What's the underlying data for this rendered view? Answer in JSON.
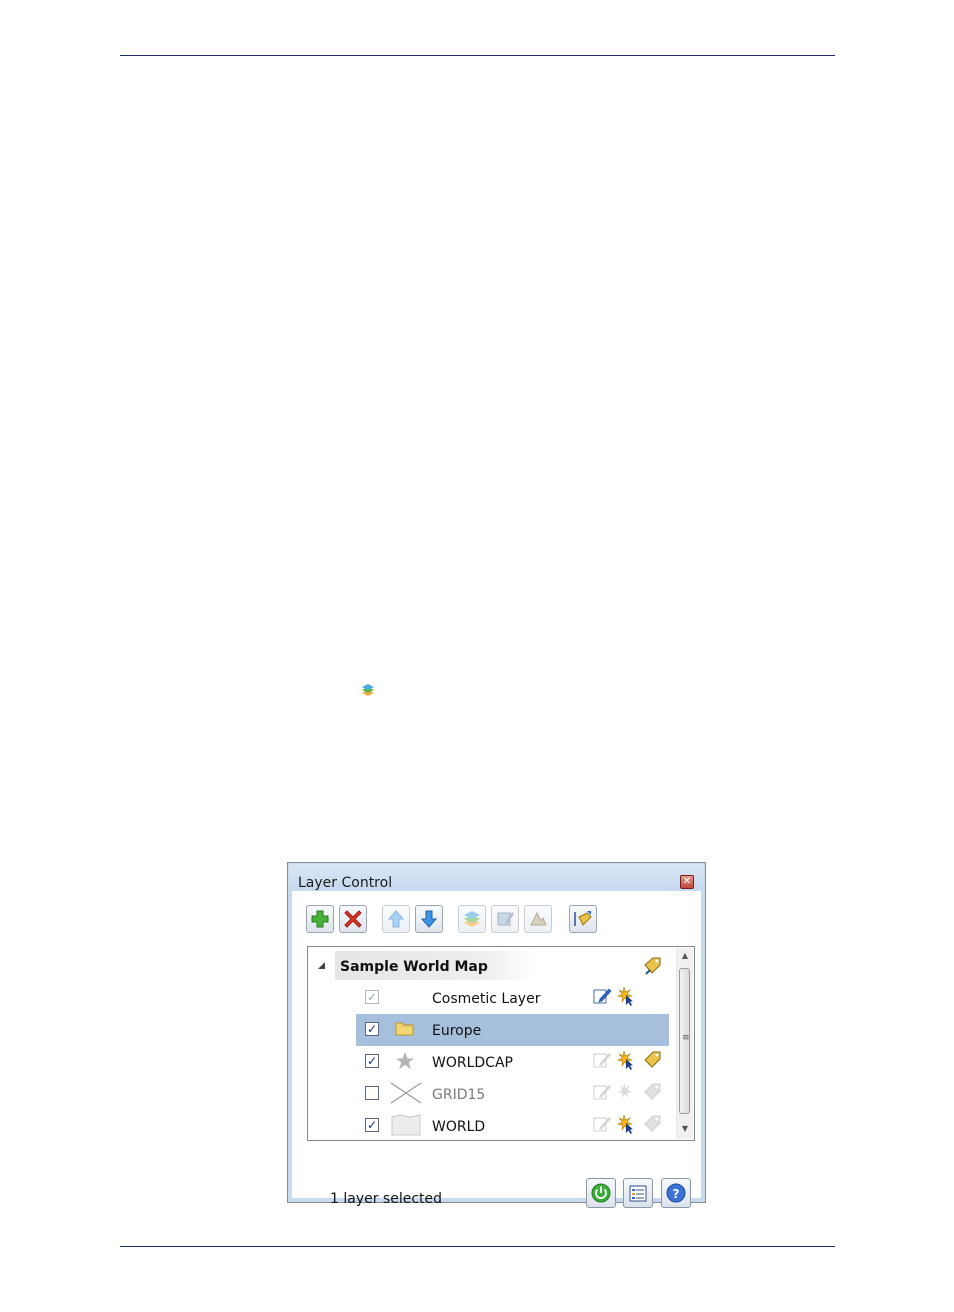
{
  "dialog": {
    "title": "Layer Control",
    "close_icon": "close-icon"
  },
  "toolbar": {
    "buttons": [
      {
        "name": "add-layer-button",
        "icon": "plus-icon",
        "enabled": true
      },
      {
        "name": "remove-layer-button",
        "icon": "x-icon",
        "enabled": true
      },
      {
        "name": "move-up-button",
        "icon": "arrow-up-icon",
        "enabled": false
      },
      {
        "name": "move-down-button",
        "icon": "arrow-down-icon",
        "enabled": true
      },
      {
        "name": "layer-properties-button",
        "icon": "layers-icon",
        "enabled": false
      },
      {
        "name": "style-button",
        "icon": "style-icon",
        "enabled": false
      },
      {
        "name": "theme-button",
        "icon": "theme-icon",
        "enabled": false
      },
      {
        "name": "label-button",
        "icon": "label-icon",
        "enabled": true
      }
    ]
  },
  "tree": {
    "root": {
      "label": "Sample World Map",
      "expanded": true
    },
    "layers": [
      {
        "name": "Cosmetic Layer",
        "checked": true,
        "check_enabled": false,
        "icon": "none",
        "selected": false,
        "dim": false
      },
      {
        "name": "Europe",
        "checked": true,
        "check_enabled": true,
        "icon": "folder-icon",
        "selected": true,
        "dim": false
      },
      {
        "name": "WORLDCAP",
        "checked": true,
        "check_enabled": true,
        "icon": "star-icon",
        "selected": false,
        "dim": false
      },
      {
        "name": "GRID15",
        "checked": false,
        "check_enabled": true,
        "icon": "grid-lines-icon",
        "selected": false,
        "dim": true
      },
      {
        "name": "WORLD",
        "checked": true,
        "check_enabled": true,
        "icon": "region-icon",
        "selected": false,
        "dim": false
      }
    ]
  },
  "status": {
    "text": "1 layer selected"
  },
  "colors": {
    "selection": "#a6bfdc",
    "frame": "#c8daf0",
    "rule": "#1f2a6b"
  }
}
